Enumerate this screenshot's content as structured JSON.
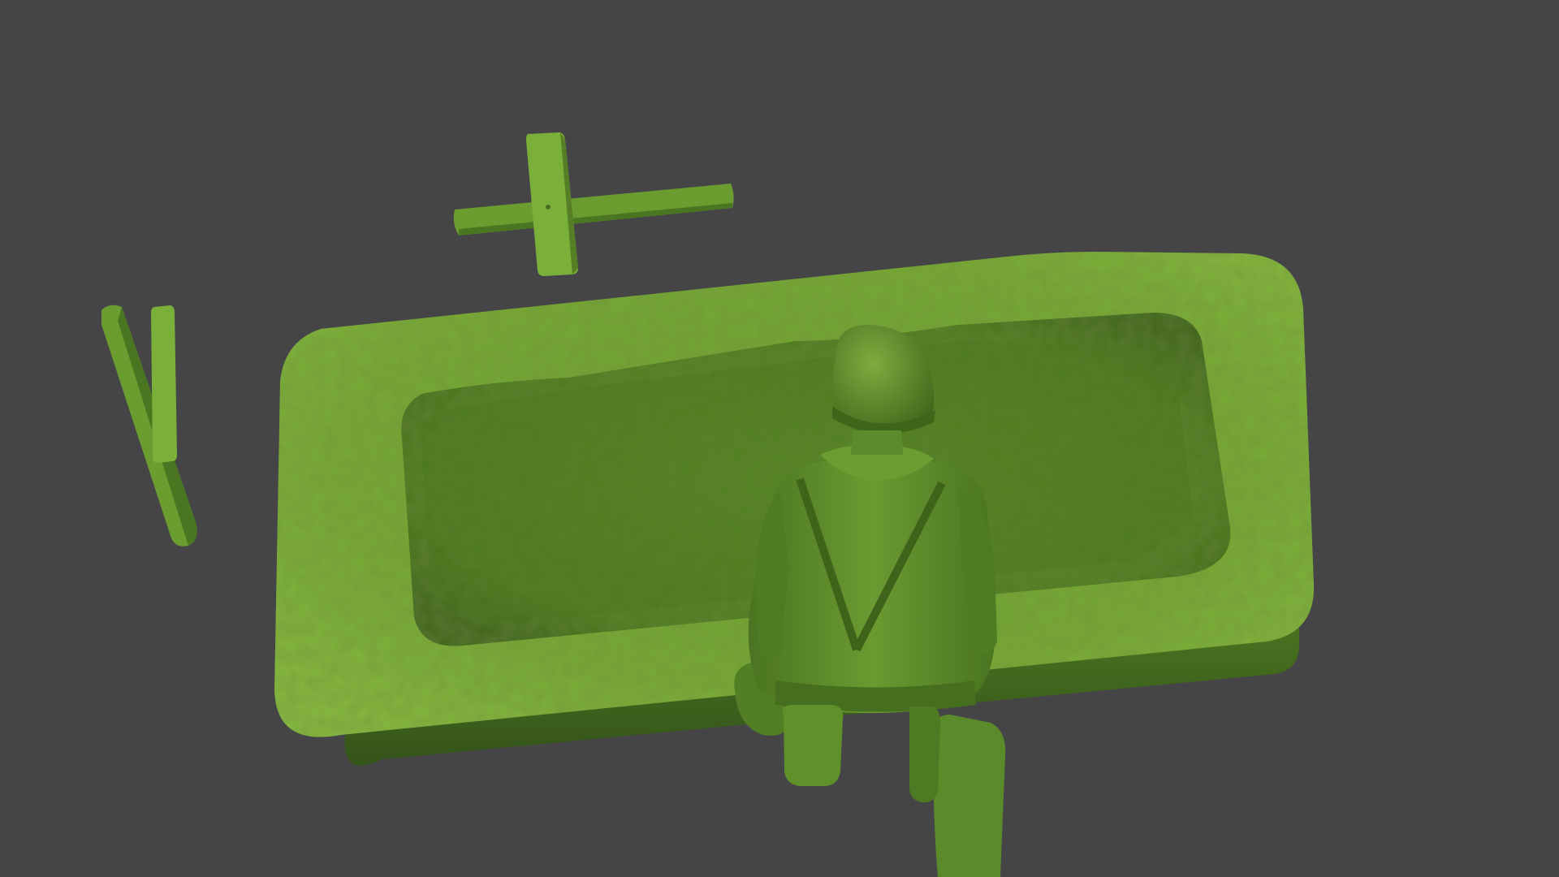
{
  "scene": {
    "background_color": "#454547",
    "objects": [
      "trench-base",
      "wooden-cross-marker",
      "broken-cross-marker",
      "kneeling-soldier-figure"
    ],
    "colors": {
      "plastic_light": "#7fb13a",
      "plastic_mid": "#5f8f2a",
      "plastic_dark": "#3c5e1a",
      "plastic_shadow": "#2b4412"
    }
  }
}
